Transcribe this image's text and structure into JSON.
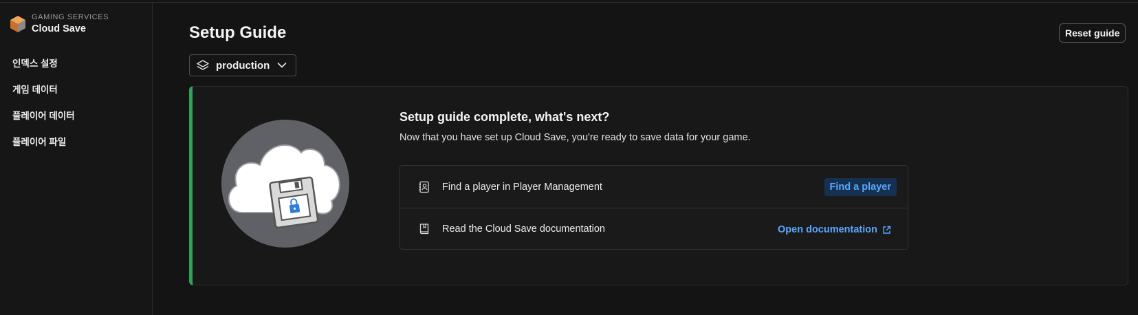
{
  "sidebar": {
    "brand_sub": "GAMING SERVICES",
    "brand_title": "Cloud Save",
    "items": [
      {
        "label": "인덱스 설정"
      },
      {
        "label": "게임 데이터"
      },
      {
        "label": "플레이어 데이터"
      },
      {
        "label": "플레이어 파일"
      }
    ]
  },
  "header": {
    "title": "Setup Guide",
    "reset_label": "Reset guide",
    "environment": "production"
  },
  "card": {
    "heading": "Setup guide complete, what's next?",
    "description": "Now that you have set up Cloud Save, you're ready to save data for your game.",
    "tasks": [
      {
        "text": "Find a player in Player Management",
        "action": "Find a player",
        "icon": "contact-book-icon"
      },
      {
        "text": "Read the Cloud Save documentation",
        "action": "Open documentation",
        "icon": "book-icon"
      }
    ]
  },
  "colors": {
    "accent_green": "#2fa35c",
    "link_blue": "#5aa7ff",
    "pill_bg": "#16304f",
    "background": "#141414"
  }
}
